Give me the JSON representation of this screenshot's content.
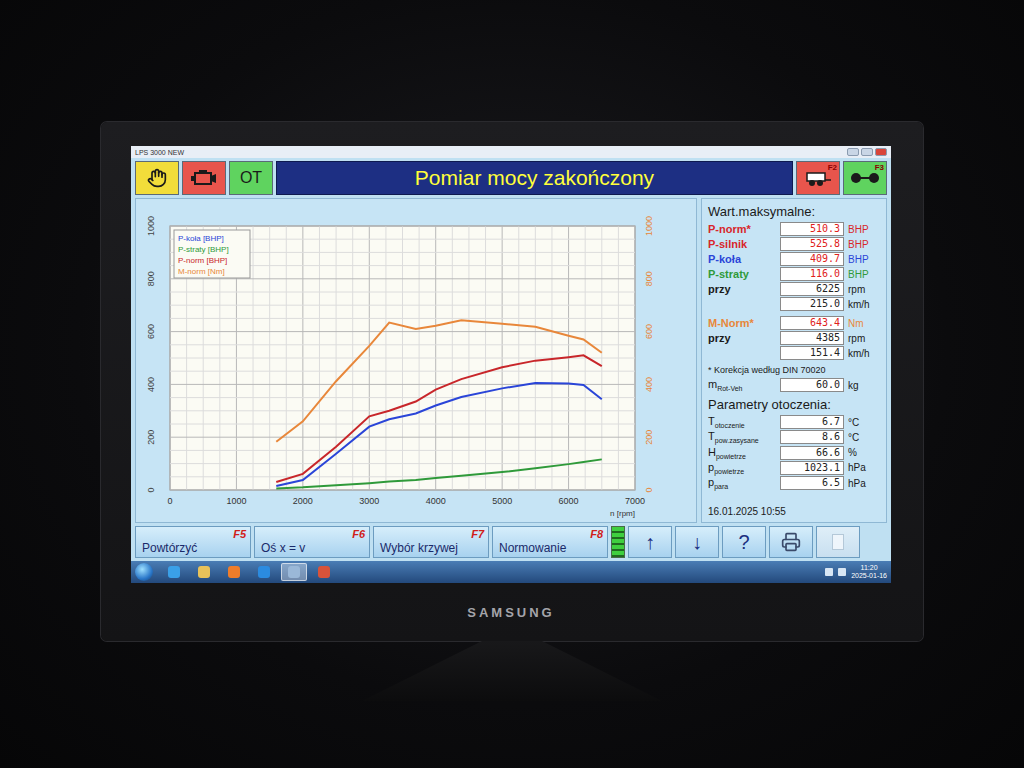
{
  "monitor": {
    "brand": "SAMSUNG"
  },
  "window": {
    "title": "LPS 3000 NEW"
  },
  "toolbar": {
    "left_buttons": [
      {
        "kind": "hand",
        "label": "",
        "color": "#f2dd3a"
      },
      {
        "kind": "engine",
        "label": "",
        "color": "#e8554c"
      },
      {
        "kind": "text",
        "label": "OT",
        "color": "#5fd35f"
      }
    ],
    "title": "Pomiar mocy zakończony",
    "right_buttons": [
      {
        "kind": "trailer",
        "key": "F2",
        "color": "#e8554c"
      },
      {
        "kind": "rollers",
        "key": "F3",
        "color": "#5fd35f"
      }
    ]
  },
  "chart": {
    "x_max": 7000,
    "y_max": 1000,
    "x_ticks": [
      "0",
      "1000",
      "2000",
      "3000",
      "4000",
      "5000",
      "6000",
      "7000"
    ],
    "x_label": "n [rpm]",
    "y_ticks_left": [
      "0",
      "200",
      "400",
      "600",
      "800",
      "1000"
    ],
    "y_ticks_right": [
      "0",
      "200",
      "400",
      "600",
      "800",
      "1000"
    ],
    "rpm": [
      1600,
      2000,
      2500,
      3000,
      3300,
      3700,
      4000,
      4385,
      5000,
      5500,
      6000,
      6225,
      6500
    ],
    "series": [
      {
        "name": "P-koła [BHP]",
        "color": "#2a45d8",
        "values": [
          15,
          38,
          137,
          240,
          268,
          290,
          320,
          352,
          385,
          405,
          403,
          398,
          344
        ]
      },
      {
        "name": "P-straty [BHP]",
        "color": "#2f9a3a",
        "values": [
          6,
          10,
          18,
          26,
          32,
          38,
          45,
          54,
          68,
          82,
          98,
          106,
          116
        ]
      },
      {
        "name": "P-norm [BHP]",
        "color": "#c8262a",
        "values": [
          30,
          61,
          164,
          279,
          300,
          335,
          380,
          420,
          465,
          490,
          503,
          510,
          469
        ]
      },
      {
        "name": "M-norm [Nm]",
        "color": "#e8873a",
        "values": [
          183,
          260,
          412,
          546,
          634,
          610,
          622,
          643,
          630,
          618,
          584,
          570,
          520
        ]
      }
    ]
  },
  "maxima": {
    "title": "Wart.maksymalne:",
    "rows": [
      {
        "label": "P-norm*",
        "value": "510.3",
        "unit": "BHP",
        "color": "#d8262a",
        "highlight": true
      },
      {
        "label": "P-silnik",
        "value": "525.8",
        "unit": "BHP",
        "color": "#d8262a",
        "highlight": true
      },
      {
        "label": "P-koła",
        "value": "409.7",
        "unit": "BHP",
        "color": "#2a45d8",
        "highlight": true
      },
      {
        "label": "P-straty",
        "value": "116.0",
        "unit": "BHP",
        "color": "#2f9a3a",
        "highlight": true
      },
      {
        "label": "przy",
        "value": "6225",
        "unit": "rpm",
        "color": "#1a1a1a",
        "highlight": false
      },
      {
        "label": "",
        "value": "215.0",
        "unit": "km/h",
        "color": "#1a1a1a",
        "highlight": false
      }
    ],
    "torque_rows": [
      {
        "label": "M-Norm*",
        "value": "643.4",
        "unit": "Nm",
        "color": "#e8873a",
        "highlight": true
      },
      {
        "label": "przy",
        "value": "4385",
        "unit": "rpm",
        "color": "#1a1a1a",
        "highlight": false
      },
      {
        "label": "",
        "value": "151.4",
        "unit": "km/h",
        "color": "#1a1a1a",
        "highlight": false
      }
    ],
    "note": "* Korekcja według DIN 70020",
    "mass": {
      "label": "m",
      "sub": "Rot-Veh",
      "value": "60.0",
      "unit": "kg"
    }
  },
  "ambient": {
    "title": "Parametry otoczenia:",
    "rows": [
      {
        "label": "T",
        "sub": "otoczenie",
        "value": "6.7",
        "unit": "°C"
      },
      {
        "label": "T",
        "sub": "pow.zasysane",
        "value": "8.6",
        "unit": "°C"
      },
      {
        "label": "H",
        "sub": "powietrze",
        "value": "66.6",
        "unit": "%"
      },
      {
        "label": "p",
        "sub": "powietrze",
        "value": "1023.1",
        "unit": "hPa"
      },
      {
        "label": "p",
        "sub": "para",
        "value": "6.5",
        "unit": "hPa"
      }
    ]
  },
  "timestamp": "16.01.2025 10:55",
  "bottom_buttons": [
    {
      "label": "Powtórzyć",
      "key": "F5"
    },
    {
      "label": "Oś x = v",
      "key": "F6"
    },
    {
      "label": "Wybór krzywej",
      "key": "F7"
    },
    {
      "label": "Normowanie",
      "key": "F8"
    }
  ],
  "indicator": {
    "level": 1
  },
  "nav_buttons": [
    {
      "kind": "text",
      "label": "↑",
      "disabled": false
    },
    {
      "kind": "text",
      "label": "↓",
      "disabled": false
    },
    {
      "kind": "text",
      "label": "?",
      "disabled": false
    },
    {
      "kind": "printer",
      "label": "",
      "disabled": false
    },
    {
      "kind": "blank",
      "label": "",
      "disabled": true
    }
  ],
  "taskbar": {
    "apps": [
      {
        "kind": "ie",
        "selected": false
      },
      {
        "kind": "folder",
        "selected": false
      },
      {
        "kind": "media",
        "selected": false
      },
      {
        "kind": "browser",
        "selected": false
      },
      {
        "kind": "window",
        "selected": true
      },
      {
        "kind": "tool",
        "selected": false
      }
    ],
    "time": "11:20",
    "date": "2025-01-16"
  }
}
